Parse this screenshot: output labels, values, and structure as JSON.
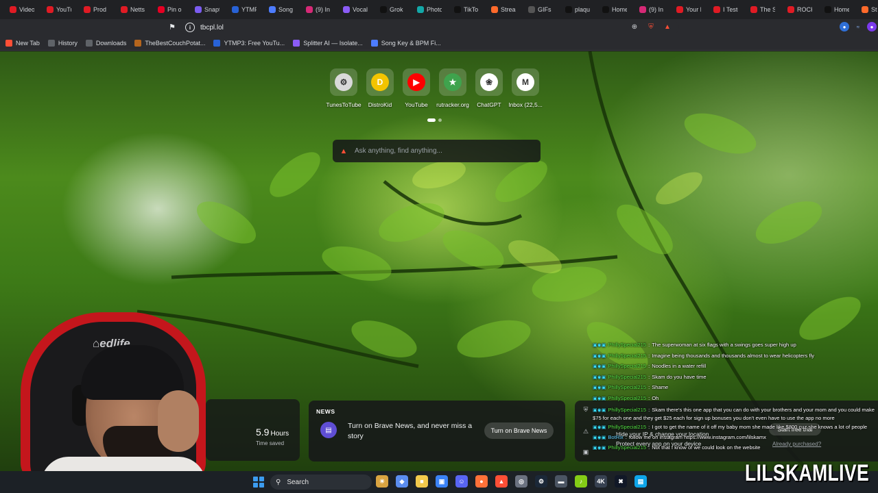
{
  "browser": {
    "tabs": [
      {
        "title": "Video",
        "icon": "youtube-icon",
        "color": "#e01b24"
      },
      {
        "title": "YouTu",
        "icon": "youtube-icon",
        "color": "#e01b24"
      },
      {
        "title": "Prod",
        "icon": "youtube-icon",
        "color": "#e01b24"
      },
      {
        "title": "Netts",
        "icon": "youtube-icon",
        "color": "#e01b24"
      },
      {
        "title": "Pin o",
        "icon": "pinterest-icon",
        "color": "#e60023"
      },
      {
        "title": "Snapt",
        "icon": "snaptik-icon",
        "color": "#7b5cf0"
      },
      {
        "title": "YTMF",
        "icon": "ytmp3-icon",
        "color": "#2862d6"
      },
      {
        "title": "Song",
        "icon": "songkey-icon",
        "color": "#4d7cff"
      },
      {
        "title": "(9) In",
        "icon": "instagram-icon",
        "color": "#d62976"
      },
      {
        "title": "Vocal",
        "icon": "splitter-icon",
        "color": "#8b5cf6"
      },
      {
        "title": "Grok",
        "icon": "x-icon",
        "color": "#111111"
      },
      {
        "title": "Photo",
        "icon": "photo-icon",
        "color": "#13a8a8"
      },
      {
        "title": "TikTo",
        "icon": "tiktok-icon",
        "color": "#111111"
      },
      {
        "title": "Strea",
        "icon": "streamlabs-icon",
        "color": "#ff6a2b"
      },
      {
        "title": "GIFs c",
        "icon": "document-icon",
        "color": "#555555"
      },
      {
        "title": "plaqu",
        "icon": "x-icon",
        "color": "#111111"
      },
      {
        "title": "Home",
        "icon": "x-icon",
        "color": "#111111"
      },
      {
        "title": "(9) In",
        "icon": "instagram-icon",
        "color": "#d62976"
      },
      {
        "title": "Your L",
        "icon": "youtube-icon",
        "color": "#e01b24"
      },
      {
        "title": "I Teste",
        "icon": "youtube-icon",
        "color": "#e01b24"
      },
      {
        "title": "The S",
        "icon": "youtube-icon",
        "color": "#e01b24"
      },
      {
        "title": "ROCK",
        "icon": "youtube-icon",
        "color": "#e01b24"
      },
      {
        "title": "Home",
        "icon": "x-icon",
        "color": "#111111"
      },
      {
        "title": "St",
        "icon": "streamlabs-icon",
        "color": "#ff6a2b"
      }
    ],
    "url": "tbcpl.lol",
    "bookmarks": [
      {
        "label": "New Tab",
        "icon": "brave-icon",
        "color": "#ff4f36"
      },
      {
        "label": "History",
        "icon": "history-icon",
        "color": "#5f6368"
      },
      {
        "label": "Downloads",
        "icon": "download-icon",
        "color": "#5f6368"
      },
      {
        "label": "TheBestCouchPotat...",
        "icon": "couch-icon",
        "color": "#b5651d"
      },
      {
        "label": "YTMP3: Free YouTu...",
        "icon": "ytmp3-icon",
        "color": "#2862d6"
      },
      {
        "label": "Splitter AI — Isolate...",
        "icon": "splitter-icon",
        "color": "#8b5cf6"
      },
      {
        "label": "Song Key & BPM Fi...",
        "icon": "songkey-icon",
        "color": "#4d7cff"
      }
    ]
  },
  "newtab": {
    "top_sites": [
      {
        "label": "TunesToTube",
        "icon": "tunestotube-icon",
        "color": "#d9d9d9",
        "glyph": "⚙"
      },
      {
        "label": "DistroKid",
        "icon": "distrokid-icon",
        "color": "#f3c400",
        "glyph": "D"
      },
      {
        "label": "YouTube",
        "icon": "youtube-icon",
        "color": "#ff0000",
        "glyph": "▶"
      },
      {
        "label": "rutracker.org",
        "icon": "rutracker-icon",
        "color": "#3fa34d",
        "glyph": "★"
      },
      {
        "label": "ChatGPT",
        "icon": "chatgpt-icon",
        "color": "#ffffff",
        "glyph": "❀"
      },
      {
        "label": "Inbox (22,5...",
        "icon": "gmail-icon",
        "color": "#ffffff",
        "glyph": "M"
      }
    ],
    "search_placeholder": "Ask anything, find anything...",
    "stats": {
      "value": "5.9",
      "unit": "Hours",
      "label": "Time saved"
    },
    "news": {
      "title": "NEWS",
      "text": "Turn on Brave News, and never miss a story",
      "button": "Turn on Brave News"
    },
    "vpn": {
      "line1": "Hide your IP & change your location",
      "line2": "Protect every app on your device",
      "button": "Start free trial",
      "link": "Already purchased?"
    }
  },
  "chat": [
    {
      "user": "PhillySpecial215",
      "text": "The superwoman at six flags with a swings goes super high up"
    },
    {
      "user": "PhillySpecial215",
      "text": "Imagine being thousands and thousands almost to wear helicopters fly"
    },
    {
      "user": "PhillySpecial215",
      "text": "Noodles in a water refill"
    },
    {
      "user": "PhillySpecial215",
      "text": "Skam do you have time"
    },
    {
      "user": "PhillySpecial215",
      "text": "Shame"
    },
    {
      "user": "PhillySpecial215",
      "text": "Oh"
    },
    {
      "user": "PhillySpecial215",
      "text": "Skam there's this one app that you can do with your brothers and your mom and you could make $75 for each one and they get $25 each for sign up bonuses you don't even have to use the app no more"
    },
    {
      "user": "PhillySpecial215",
      "text": "I got to get the name of it off my baby mom she made like $800 cuz she knows a lot of people"
    },
    {
      "user": "BotRix",
      "text": "follow me on instagram https://www.instagram.com/lilskamx",
      "bot": true
    },
    {
      "user": "PhillySpecial215",
      "text": "Not that I know of we could look on the website"
    }
  ],
  "taskbar": {
    "search_label": "Search",
    "apps": [
      {
        "icon": "widgets-icon",
        "color": "#d9a441",
        "glyph": "☀"
      },
      {
        "icon": "copilot-icon",
        "color": "#5b8def",
        "glyph": "◆"
      },
      {
        "icon": "file-explorer-icon",
        "color": "#f2c94c",
        "glyph": "■"
      },
      {
        "icon": "store-icon",
        "color": "#3b82f6",
        "glyph": "▣"
      },
      {
        "icon": "discord-icon",
        "color": "#5865f2",
        "glyph": "☺"
      },
      {
        "icon": "firefox-icon",
        "color": "#ff7139",
        "glyph": "●"
      },
      {
        "icon": "brave-icon",
        "color": "#ff4f36",
        "glyph": "▲"
      },
      {
        "icon": "chrome-icon",
        "color": "#6b7280",
        "glyph": "◎"
      },
      {
        "icon": "steam-icon",
        "color": "#1b2838",
        "glyph": "⚙"
      },
      {
        "icon": "app-icon",
        "color": "#4b5563",
        "glyph": "▬"
      },
      {
        "icon": "music-icon",
        "color": "#84cc16",
        "glyph": "♪"
      },
      {
        "icon": "4k-icon",
        "color": "#374151",
        "glyph": "4K"
      },
      {
        "icon": "capcut-icon",
        "color": "#111827",
        "glyph": "✖"
      },
      {
        "icon": "photos-icon",
        "color": "#0ea5e9",
        "glyph": "▤"
      }
    ]
  },
  "watermark": "LILSKAMLIVE"
}
